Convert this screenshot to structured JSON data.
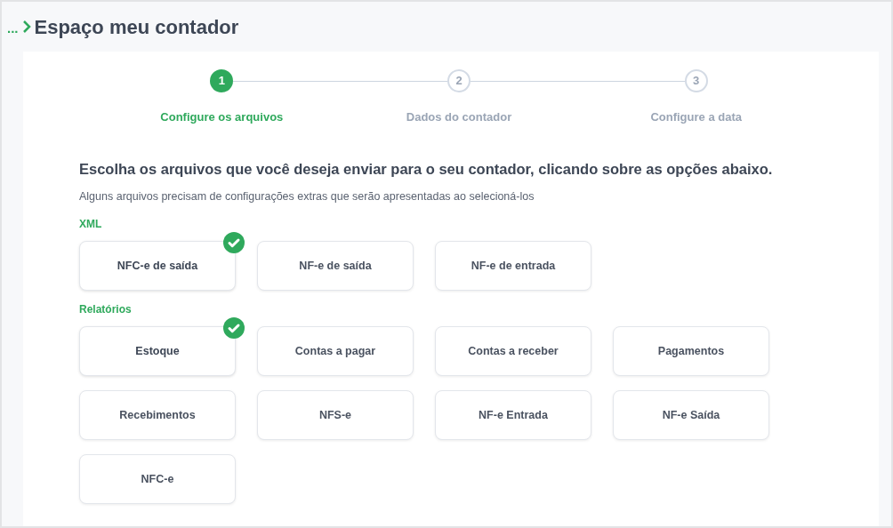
{
  "breadcrumb": {
    "ellipsis": "...",
    "title": "Espaço meu contador"
  },
  "steps": [
    {
      "number": "1",
      "label": "Configure os arquivos",
      "selected": true
    },
    {
      "number": "2",
      "label": "Dados do contador",
      "selected": false
    },
    {
      "number": "3",
      "label": "Configure a data",
      "selected": false
    }
  ],
  "heading": "Escolha os arquivos que você deseja enviar para o seu contador, clicando sobre as opções abaixo.",
  "subtitle": "Alguns arquivos precisam de configurações extras que serão apresentadas ao selecioná-los",
  "groups": [
    {
      "title": "XML",
      "options": [
        {
          "label": "NFC-e de saída",
          "selected": true
        },
        {
          "label": "NF-e de saída",
          "selected": false
        },
        {
          "label": "NF-e de entrada",
          "selected": false
        }
      ]
    },
    {
      "title": "Relatórios",
      "options": [
        {
          "label": "Estoque",
          "selected": true
        },
        {
          "label": "Contas a pagar",
          "selected": false
        },
        {
          "label": "Contas a receber",
          "selected": false
        },
        {
          "label": "Pagamentos",
          "selected": false
        },
        {
          "label": "Recebimentos",
          "selected": false
        },
        {
          "label": "NFS-e",
          "selected": false
        },
        {
          "label": "NF-e Entrada",
          "selected": false
        },
        {
          "label": "NF-e Saída",
          "selected": false
        },
        {
          "label": "NFC-e",
          "selected": false
        }
      ]
    }
  ]
}
